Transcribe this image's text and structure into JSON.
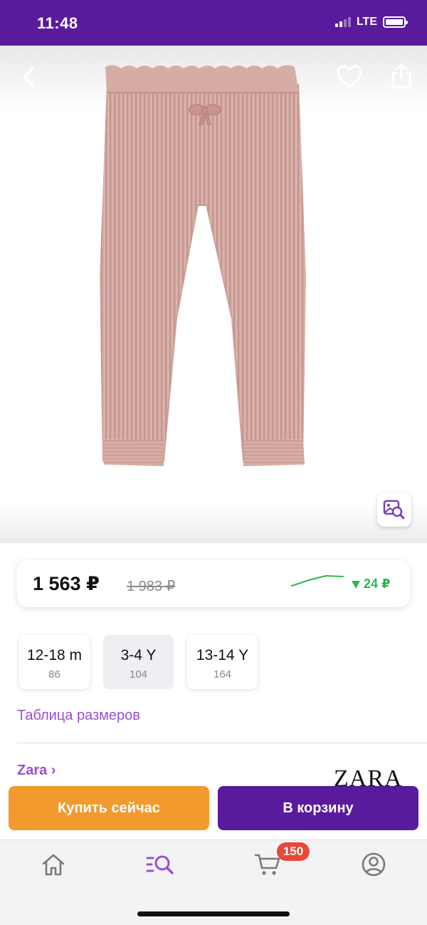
{
  "status_bar": {
    "time": "11:48",
    "network": "LTE",
    "icons": [
      "signal-icon",
      "battery-icon"
    ]
  },
  "gallery": {
    "back_icon": "chevron-left-icon",
    "favorite_icon": "heart-icon",
    "share_icon": "share-icon",
    "visual_search_icon": "image-search-icon"
  },
  "price": {
    "current": "1 563 ₽",
    "old": "1 983 ₽",
    "change": "24 ₽",
    "change_direction": "down",
    "change_color": "#2cb84b",
    "trend": [
      0.3,
      0.7,
      1.0,
      0.95
    ]
  },
  "sizes": [
    {
      "label": "12-18 m",
      "sub": "86",
      "selected": false
    },
    {
      "label": "3-4 Y",
      "sub": "104",
      "selected": true
    },
    {
      "label": "13-14 Y",
      "sub": "164",
      "selected": false
    }
  ],
  "size_table_link": "Таблица размеров",
  "brand": {
    "name": "Zara ›",
    "logo_text": "ZARA"
  },
  "actions": {
    "buy_now": "Купить сейчас",
    "add_to_cart": "В корзину"
  },
  "tab_bar": {
    "tabs": [
      {
        "name": "home",
        "icon": "home-icon"
      },
      {
        "name": "catalog",
        "icon": "search-catalog-icon",
        "active": true
      },
      {
        "name": "cart",
        "icon": "cart-icon"
      },
      {
        "name": "profile",
        "icon": "profile-icon"
      }
    ],
    "cart_badge": "150",
    "active_color": "#9a4fd0"
  },
  "colors": {
    "brand_purple": "#5a1a9e",
    "accent_purple": "#9a4fd0",
    "buy_orange": "#f29a2e",
    "badge_red": "#e7483a"
  }
}
